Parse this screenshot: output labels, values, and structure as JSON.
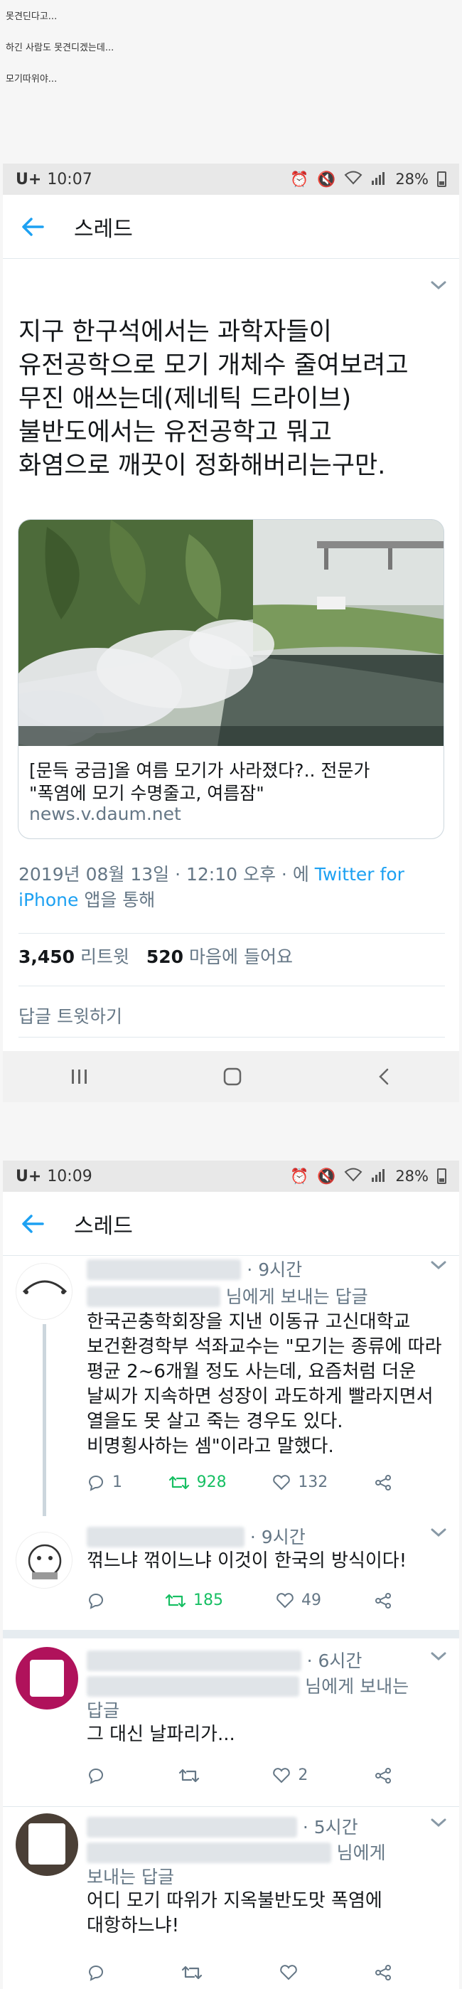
{
  "captions": [
    "못견딘다고...",
    "하긴 사람도 못견디겠는데...",
    "모기따위야..."
  ],
  "screen1": {
    "status": {
      "carrier": "U+",
      "time": "10:07",
      "battery": "28%"
    },
    "nav": {
      "title": "스레드"
    },
    "tweet": {
      "text_lines": [
        "지구 한구석에서는 과학자들이",
        "유전공학으로 모기 개체수 줄여보려고",
        "무진 애쓰는데(제네틱 드라이브)",
        "불반도에서는 유전공학고 뭐고",
        "화염으로 깨끗이 정화해버리는구만."
      ],
      "card": {
        "title_lines": [
          "[문득 궁금]올 여름 모기가 사라졌다?.. 전문가",
          "\"폭염에 모기 수명줄고, 여름잠\""
        ],
        "domain": "news.v.daum.net"
      },
      "meta": {
        "date": "2019년 08월 13일 · 12:10 오후 · 에",
        "via": "Twitter for iPhone",
        "suffix": "앱을 통해"
      },
      "stats": {
        "retweets": "3,450",
        "retweets_label": "리트윗",
        "likes": "520",
        "likes_label": "마음에 들어요"
      },
      "reply_placeholder": "답글 트윗하기"
    }
  },
  "screen2": {
    "status": {
      "carrier": "U+",
      "time": "10:09",
      "battery": "28%"
    },
    "nav": {
      "title": "스레드"
    },
    "replies": [
      {
        "time": "· 9시간",
        "reply_to_suffix": "님에게 보내는 답글",
        "body_lines": [
          "한국곤충학회장을 지낸 이동규 고신대학교",
          "보건환경학부 석좌교수는 \"모기는 종류에 따라",
          "평균 2~6개월 정도 사는데, 요즘처럼 더운",
          "날씨가 지속하면 성장이 과도하게 빨라지면서",
          "열을도 못 살고 죽는 경우도 있다.",
          "비명횡사하는 셈\"이라고 말했다."
        ],
        "counts": {
          "reply": "1",
          "retweet": "928",
          "like": "132"
        }
      },
      {
        "time": "· 9시간",
        "body_lines": [
          "꺾느냐 꺾이느냐 이것이 한국의 방식이다!"
        ],
        "counts": {
          "reply": "",
          "retweet": "185",
          "like": "49"
        }
      },
      {
        "time": "· 6시간",
        "reply_to_suffix": "님에게 보내는",
        "reply_to_suffix2": "답글",
        "body_lines": [
          "그 대신 날파리가..."
        ],
        "counts": {
          "reply": "",
          "retweet": "",
          "like": "2"
        }
      },
      {
        "time": "· 5시간",
        "reply_to_suffix": "님에게",
        "reply_to_suffix2": "보내는 답글",
        "body_lines": [
          "어디 모기 따위가 지옥불반도맛 폭염에",
          "대항하느냐!"
        ],
        "counts": {
          "reply": "",
          "retweet": "",
          "like": ""
        }
      }
    ]
  },
  "colors": {
    "accent": "#1da1f2",
    "retweet": "#17bf63",
    "muted": "#657786",
    "text": "#14171a"
  }
}
